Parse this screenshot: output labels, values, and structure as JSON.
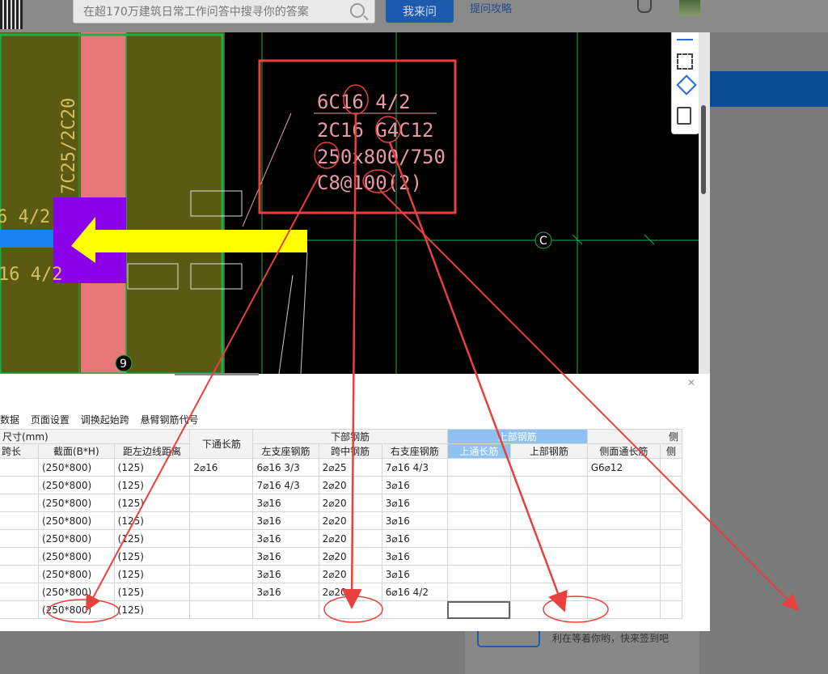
{
  "site": {
    "search_placeholder": "在超170万建筑日常工作问答中搜寻你的答案",
    "ask_button": "我来问",
    "tips_link": "提问攻略",
    "sign_text": "利在等着你哟，快来签到吧"
  },
  "cad": {
    "annotation_lines": [
      "6C16 4/2",
      "2C16 G4C12",
      "250x800/750",
      "C8@100(2)"
    ],
    "left_vertical_text": "7C25/2C20",
    "left_text_1": "6 4/2",
    "left_text_2": "16 4/2",
    "axis_c": "C",
    "axis_9": "9"
  },
  "toolbar": [
    "数据",
    "页面设置",
    "调换起始跨",
    "悬臂钢筋代号"
  ],
  "table": {
    "group_row": {
      "size": "尺寸(mm)",
      "bottom_bar": "下部钢筋",
      "top_bar": "上部钢筋",
      "side": "侧"
    },
    "columns": [
      "跨长",
      "截面(B*H)",
      "距左边线距离",
      "下通长筋",
      "左支座钢筋",
      "跨中钢筋",
      "右支座钢筋",
      "上通长筋",
      "上部钢筋",
      "侧面通长筋",
      "侧"
    ],
    "rows": [
      [
        "",
        "(250*800)",
        "(125)",
        "2⌀16",
        "6⌀16 3/3",
        "2⌀25",
        "7⌀16 4/3",
        "",
        "",
        "G6⌀12",
        ""
      ],
      [
        "",
        "(250*800)",
        "(125)",
        "",
        "7⌀16 4/3",
        "2⌀20",
        "3⌀16",
        "",
        "",
        "",
        ""
      ],
      [
        "",
        "(250*800)",
        "(125)",
        "",
        "3⌀16",
        "2⌀20",
        "3⌀16",
        "",
        "",
        "",
        ""
      ],
      [
        "",
        "(250*800)",
        "(125)",
        "",
        "3⌀16",
        "2⌀20",
        "3⌀16",
        "",
        "",
        "",
        ""
      ],
      [
        "",
        "(250*800)",
        "(125)",
        "",
        "3⌀16",
        "2⌀20",
        "3⌀16",
        "",
        "",
        "",
        ""
      ],
      [
        "",
        "(250*800)",
        "(125)",
        "",
        "3⌀16",
        "2⌀20",
        "3⌀16",
        "",
        "",
        "",
        ""
      ],
      [
        "",
        "(250*800)",
        "(125)",
        "",
        "3⌀16",
        "2⌀20",
        "3⌀16",
        "",
        "",
        "",
        ""
      ],
      [
        "",
        "(250*800)",
        "(125)",
        "",
        "3⌀16",
        "2⌀20",
        "6⌀16 4/2",
        "",
        "",
        "",
        ""
      ],
      [
        "",
        "(250*800)",
        "(125)",
        "",
        "",
        "",
        "",
        "",
        "",
        "",
        ""
      ]
    ]
  },
  "colors": {
    "annotation": "#e03a3a",
    "cad_bg": "#000000",
    "accent": "#1b5cae",
    "highlight_header": "#8fc2f2"
  }
}
